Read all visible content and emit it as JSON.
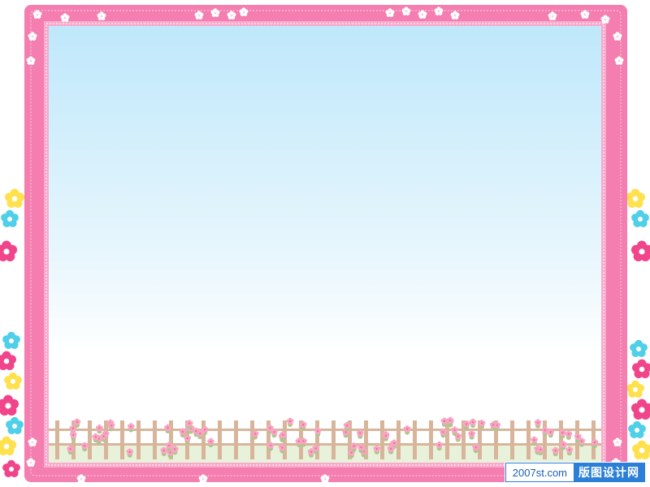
{
  "watermark": {
    "domain": "2007st.com",
    "name": "版图设计网"
  },
  "colors": {
    "frame_pink": "#f47eb0",
    "frame_light": "#f9a9cc",
    "sky_top": "#bfe8fb",
    "sky_bottom": "#ffffff",
    "fence_wood": "#d8b59a",
    "rose_pink": "#f7a6c2",
    "leaf_green": "#a8c98a",
    "watermark_blue": "#2b7fd6"
  },
  "decor": {
    "side_flowers": [
      "pink-flower",
      "yellow-flower",
      "cyan-flower",
      "magenta-flower"
    ],
    "frame_flowers": "white-blossom",
    "bottom": "rose-fence"
  }
}
